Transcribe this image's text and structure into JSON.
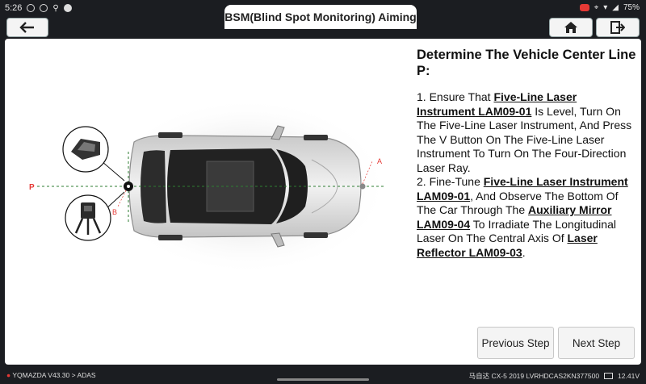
{
  "status": {
    "time": "5:26",
    "battery": "75%"
  },
  "title": "BSM(Blind Spot Monitoring) Aiming",
  "instructions": {
    "heading": "Determine The Vehicle Center Line P:",
    "step1_prefix": "1. Ensure That ",
    "step1_link": "Five-Line Laser Instrument LAM09-01",
    "step1_suffix": " Is Level, Turn On The Five-Line Laser Instrument, And Press The V Button On The Five-Line Laser Instrument To Turn On The Four-Direction Laser Ray.",
    "step2_prefix": "2. Fine-Tune ",
    "step2_link1": "Five-Line Laser Instrument LAM09-01",
    "step2_mid1": ", And Observe The Bottom Of The Car Through The ",
    "step2_link2": "Auxiliary Mirror LAM09-04",
    "step2_mid2": " To Irradiate The Longitudinal Laser On The Central Axis Of ",
    "step2_link3": "Laser Reflector LAM09-03",
    "step2_end": "."
  },
  "diagram": {
    "label_p": "P",
    "label_a": "A",
    "label_b": "B"
  },
  "buttons": {
    "previous": "Previous Step",
    "next": "Next Step"
  },
  "footer": {
    "breadcrumb": "YQMAZDA V43.30 > ADAS",
    "vehicle": "马自达 CX-5 2019  LVRHDCAS2KN377500",
    "voltage": "12.41V"
  },
  "colors": {
    "laser_green": "#2e7d32",
    "marker_red": "#e53935"
  }
}
